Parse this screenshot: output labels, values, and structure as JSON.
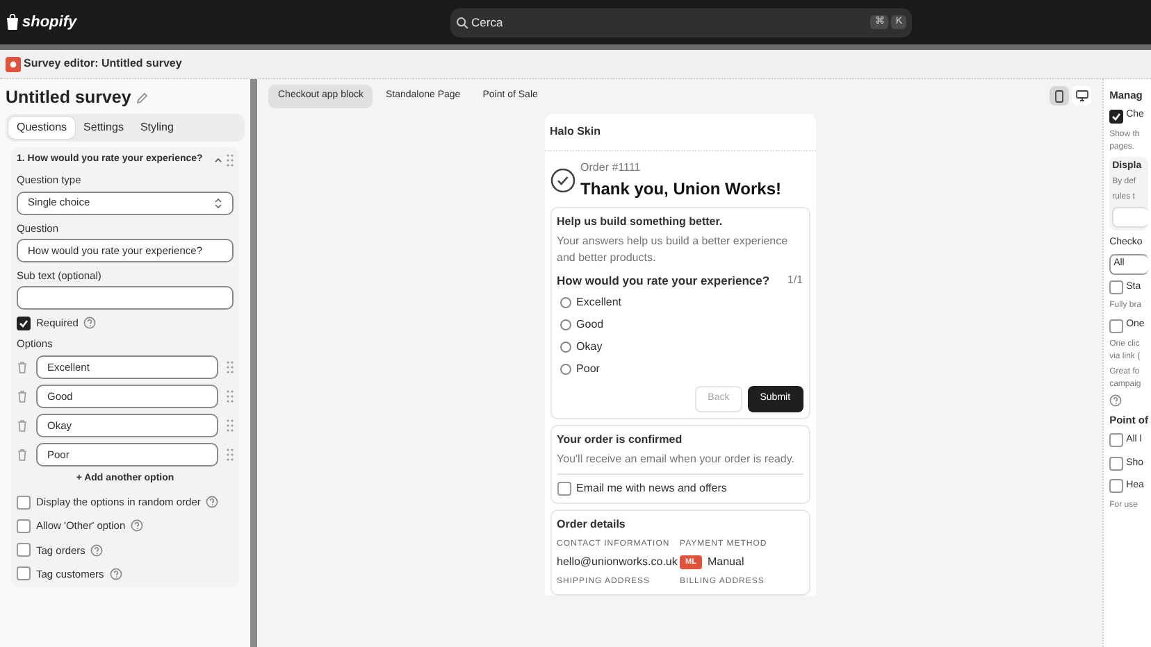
{
  "topbar": {
    "brand": "shopify",
    "search_placeholder": "Cerca",
    "shortcut_keys": [
      "⌘",
      "K"
    ]
  },
  "app": {
    "title": "Survey editor: Untitled survey"
  },
  "editor": {
    "survey_title": "Untitled survey",
    "tabs": [
      {
        "label": "Questions",
        "selected": true
      },
      {
        "label": "Settings",
        "selected": false
      },
      {
        "label": "Styling",
        "selected": false
      }
    ],
    "question": {
      "title": "1. How would you rate your experience?",
      "expanded": true,
      "type_label": "Question type",
      "type_value": "Single choice",
      "question_label": "Question",
      "question_value": "How would you rate your experience?",
      "subtext_label": "Sub text (optional)",
      "required": {
        "label": "Required",
        "checked": true
      },
      "options_label": "Options",
      "options": [
        "Excellent",
        "Good",
        "Okay",
        "Poor"
      ],
      "add_option": "+ Add another option",
      "settings": [
        {
          "label": "Display the options in random order",
          "checked": false
        },
        {
          "label": "Allow 'Other' option",
          "checked": false
        },
        {
          "label": "Tag orders",
          "checked": false
        },
        {
          "label": "Tag customers",
          "checked": false
        }
      ]
    }
  },
  "preview": {
    "tabs": [
      {
        "label": "Checkout app block",
        "selected": true
      },
      {
        "label": "Standalone Page",
        "selected": false
      },
      {
        "label": "Point of Sale",
        "selected": false
      }
    ],
    "devices": [
      {
        "kind": "mobile",
        "selected": true
      },
      {
        "kind": "desktop",
        "selected": false
      }
    ],
    "shop_name": "Halo Skin",
    "order_number": "Order #1111",
    "thank_you": "Thank you, Union Works!",
    "survey": {
      "heading": "Help us build something better.",
      "intro": "Your answers help us build a better experience and better products.",
      "question": "How would you rate your experience?",
      "progress": "1/1",
      "choices": [
        {
          "label": "Excellent",
          "selected": false
        },
        {
          "label": "Good",
          "selected": false
        },
        {
          "label": "Okay",
          "selected": false
        },
        {
          "label": "Poor",
          "selected": false
        }
      ],
      "back": {
        "label": "Back",
        "disabled": true
      },
      "submit": "Submit"
    },
    "confirmation": {
      "title": "Your order is confirmed",
      "text": "You'll receive an email when your order is ready.",
      "newsletter": {
        "label": "Email me with news and offers",
        "checked": false
      }
    },
    "order_details": {
      "title": "Order details",
      "fields": [
        {
          "label": "CONTACT INFORMATION",
          "value": "hello@unionworks.co.uk"
        },
        {
          "label": "PAYMENT METHOD",
          "value": "Manual",
          "badge": "ML"
        }
      ],
      "more_labels": [
        "SHIPPING ADDRESS",
        "BILLING ADDRESS"
      ]
    }
  },
  "manage": {
    "items": [
      {
        "kind": "heading",
        "text": "Manag"
      },
      {
        "kind": "checkbox",
        "text": "Che",
        "checked": true
      },
      {
        "kind": "text",
        "lines": [
          "Show th",
          "pages."
        ]
      },
      {
        "kind": "box",
        "title": "Displa",
        "lines": [
          "By def",
          "rules t"
        ]
      },
      {
        "kind": "label",
        "text": "Checko"
      },
      {
        "kind": "select",
        "text": "All"
      },
      {
        "kind": "checkbox",
        "text": "Sta",
        "checked": false
      },
      {
        "kind": "text",
        "lines": [
          "Fully bra"
        ]
      },
      {
        "kind": "checkbox",
        "text": "One",
        "checked": false
      },
      {
        "kind": "text",
        "lines": [
          "One clic",
          "via link ("
        ]
      },
      {
        "kind": "text",
        "lines": [
          "Great fo",
          "campaig"
        ]
      },
      {
        "kind": "help"
      },
      {
        "kind": "heading",
        "text": "Point of"
      },
      {
        "kind": "checkbox",
        "text": "All l",
        "checked": false
      },
      {
        "kind": "checkbox",
        "text": "Sho",
        "checked": false
      },
      {
        "kind": "checkbox",
        "text": "Hea",
        "checked": false
      },
      {
        "kind": "text",
        "lines": [
          "For use"
        ]
      }
    ]
  }
}
